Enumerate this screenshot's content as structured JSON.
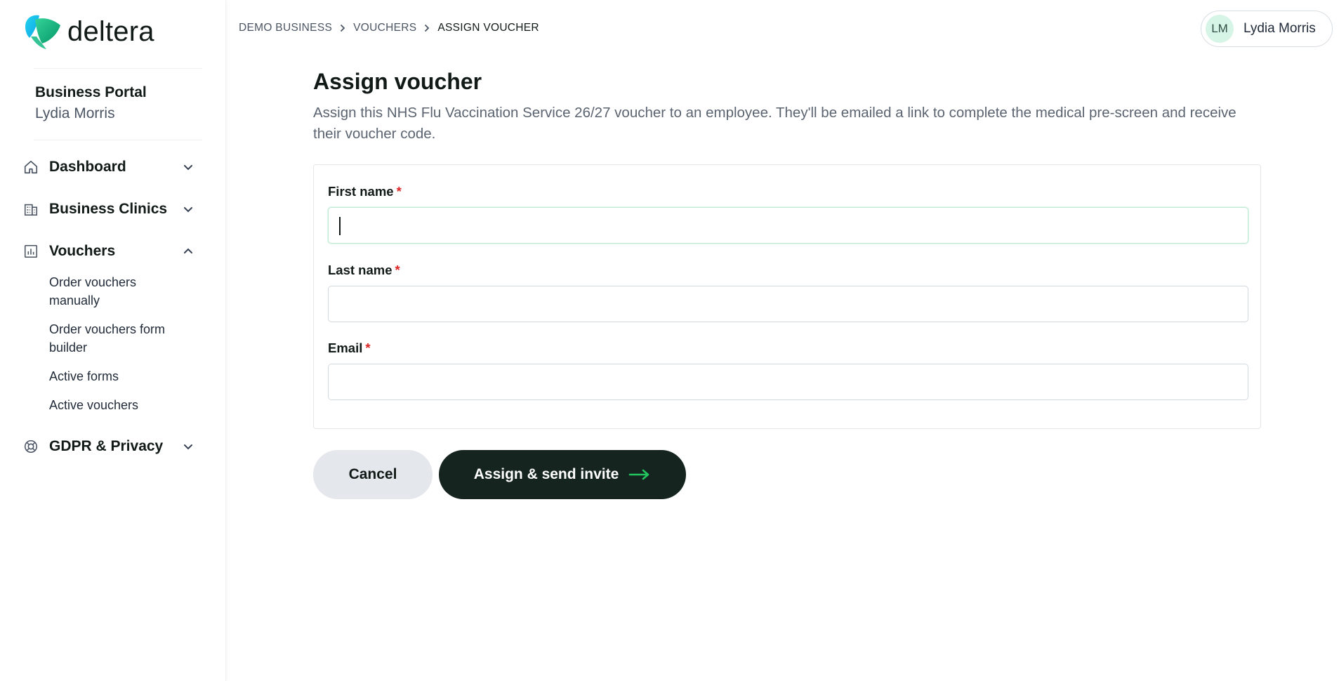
{
  "brand": {
    "name": "deltera",
    "accent": "#22c55e",
    "logo_colors": [
      "#22d3ee",
      "#10b981"
    ]
  },
  "sidebar": {
    "portal_title": "Business Portal",
    "portal_user": "Lydia Morris",
    "nav": [
      {
        "label": "Dashboard",
        "icon": "home-icon",
        "expanded": false
      },
      {
        "label": "Business Clinics",
        "icon": "building-icon",
        "expanded": false
      },
      {
        "label": "Vouchers",
        "icon": "chart-icon",
        "expanded": true,
        "children": [
          {
            "label": "Order vouchers manually"
          },
          {
            "label": "Order vouchers form builder"
          },
          {
            "label": "Active forms"
          },
          {
            "label": "Active vouchers"
          }
        ]
      },
      {
        "label": "GDPR & Privacy",
        "icon": "lifebuoy-icon",
        "expanded": false
      }
    ]
  },
  "header": {
    "breadcrumb": [
      "DEMO BUSINESS",
      "VOUCHERS",
      "ASSIGN VOUCHER"
    ],
    "user": {
      "initials": "LM",
      "name": "Lydia Morris"
    }
  },
  "main": {
    "title": "Assign voucher",
    "description": "Assign this NHS Flu Vaccination Service 26/27 voucher to an employee. They'll be emailed a link to complete the medical pre-screen and receive their voucher code.",
    "form": {
      "fields": [
        {
          "label": "First name",
          "required_mark": "*",
          "value": ""
        },
        {
          "label": "Last name",
          "required_mark": "*",
          "value": ""
        },
        {
          "label": "Email",
          "required_mark": "*",
          "value": ""
        }
      ]
    },
    "actions": {
      "cancel_label": "Cancel",
      "submit_label": "Assign & send invite"
    }
  }
}
